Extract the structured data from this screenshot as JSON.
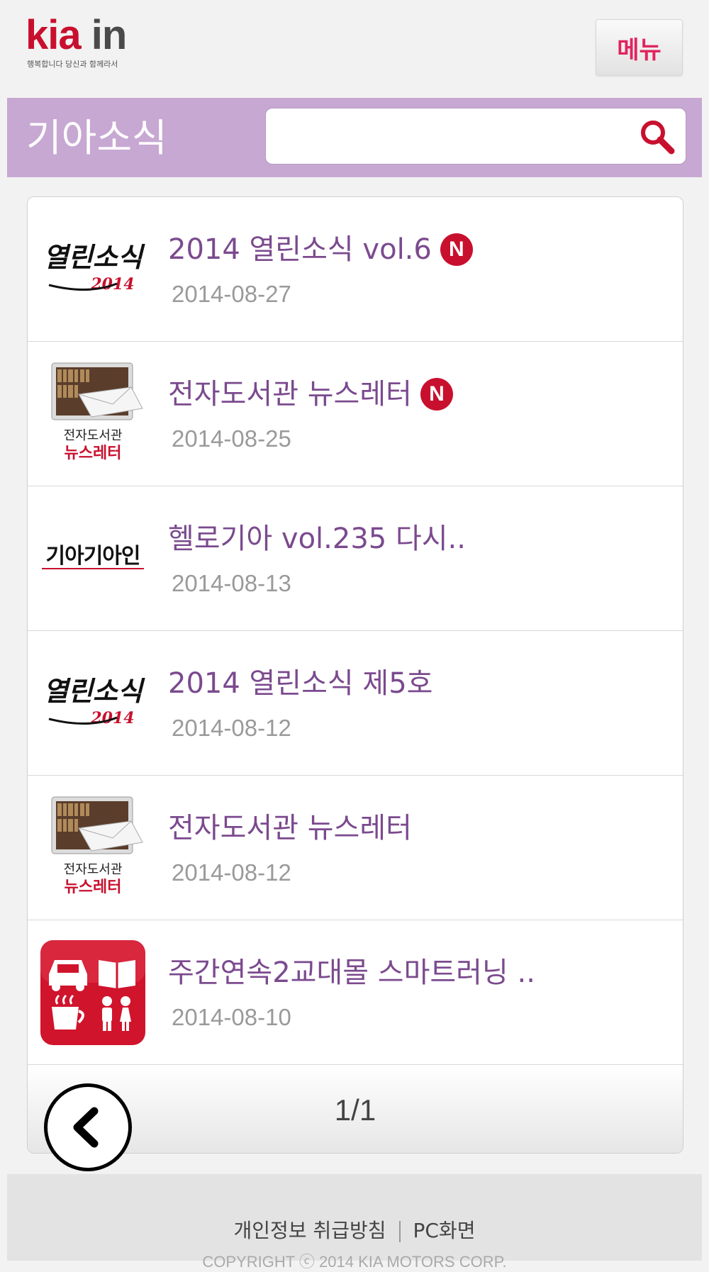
{
  "header": {
    "logo_kia": "kia",
    "logo_in": "in",
    "logo_tagline": "행복합니다 당신과 함께라서",
    "menu_label": "메뉴"
  },
  "title_bar": {
    "title": "기아소식",
    "search_value": "",
    "search_placeholder": ""
  },
  "items": [
    {
      "title": "2014 열린소식 vol.6",
      "date": "2014-08-27",
      "is_new": true,
      "thumb": "open-news-2014-thumbnail",
      "thumb_text": "열린소식",
      "thumb_sub": "2014"
    },
    {
      "title": "전자도서관 뉴스레터",
      "date": "2014-08-25",
      "is_new": true,
      "thumb": "e-library-newsletter-thumbnail",
      "thumb_text": "전자도서관",
      "thumb_sub": "뉴스레터"
    },
    {
      "title": "헬로기아 vol.235 다시..",
      "date": "2014-08-13",
      "is_new": false,
      "thumb": "kia-kia-in-thumbnail",
      "thumb_text": "기아기아인"
    },
    {
      "title": "2014 열린소식 제5호",
      "date": "2014-08-12",
      "is_new": false,
      "thumb": "open-news-2014-thumbnail",
      "thumb_text": "열린소식",
      "thumb_sub": "2014"
    },
    {
      "title": "전자도서관 뉴스레터",
      "date": "2014-08-12",
      "is_new": false,
      "thumb": "e-library-newsletter-thumbnail",
      "thumb_text": "전자도서관",
      "thumb_sub": "뉴스레터"
    },
    {
      "title": "주간연속2교대몰 스마트러닝 ..",
      "date": "2014-08-10",
      "is_new": false,
      "thumb": "smart-learning-app-icon"
    }
  ],
  "new_badge_label": "N",
  "pager": {
    "text": "1/1"
  },
  "footer": {
    "privacy_link": "개인정보 취급방침",
    "pc_link": "PC화면",
    "copyright": "COPYRIGHT ⓒ 2014 KIA MOTORS CORP."
  },
  "colors": {
    "brand_red": "#c8102e",
    "title_bar": "#c7a8d2",
    "item_title": "#7b4a8e",
    "date": "#9a9a9a"
  }
}
